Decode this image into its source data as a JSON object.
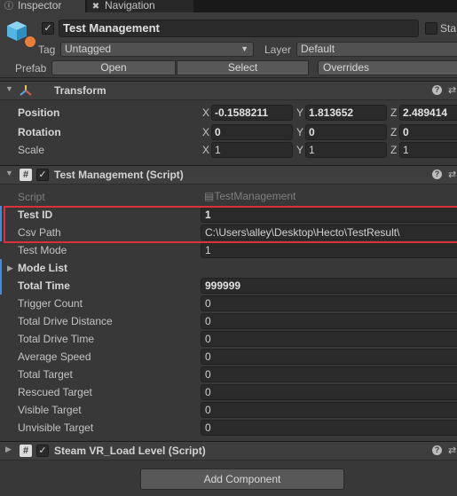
{
  "tabs": [
    {
      "label": "Inspector",
      "icon": "info-icon"
    },
    {
      "label": "Navigation",
      "icon": "compass-icon"
    }
  ],
  "object": {
    "name": "Test Management",
    "static_label": "Sta",
    "tag_label": "Tag",
    "tag_value": "Untagged",
    "layer_label": "Layer",
    "layer_value": "Default",
    "prefab_label": "Prefab",
    "prefab_open": "Open",
    "prefab_select": "Select",
    "prefab_overrides": "Overrides"
  },
  "transform": {
    "title": "Transform",
    "position": {
      "label": "Position",
      "x": "-0.1588211",
      "y": "1.813652",
      "z": "2.489414"
    },
    "rotation": {
      "label": "Rotation",
      "x": "0",
      "y": "0",
      "z": "0"
    },
    "scale": {
      "label": "Scale",
      "x": "1",
      "y": "1",
      "z": "1"
    },
    "axis_x": "X",
    "axis_y": "Y",
    "axis_z": "Z"
  },
  "script": {
    "title": "Test Management (Script)",
    "script_label": "Script",
    "script_value": "TestManagement",
    "fields": [
      {
        "label": "Test ID",
        "value": "1"
      },
      {
        "label": "Csv Path",
        "value": "C:\\Users\\alley\\Desktop\\Hecto\\TestResult\\"
      },
      {
        "label": "Test Mode",
        "value": "1"
      },
      {
        "label": "Mode List",
        "value": ""
      },
      {
        "label": "Total Time",
        "value": "999999"
      },
      {
        "label": "Trigger Count",
        "value": "0"
      },
      {
        "label": "Total Drive Distance",
        "value": "0"
      },
      {
        "label": "Total Drive Time",
        "value": "0"
      },
      {
        "label": "Average Speed",
        "value": "0"
      },
      {
        "label": "Total Target",
        "value": "0"
      },
      {
        "label": "Rescued Target",
        "value": "0"
      },
      {
        "label": "Visible Target",
        "value": "0"
      },
      {
        "label": "Unvisible Target",
        "value": "0"
      }
    ]
  },
  "steam": {
    "title": "Steam VR_Load Level (Script)"
  },
  "add_component": "Add Component",
  "colors": {
    "highlight": "#d9303a",
    "modified_marker": "#4a8cd4",
    "accent_cube": "#4fb6e6"
  }
}
